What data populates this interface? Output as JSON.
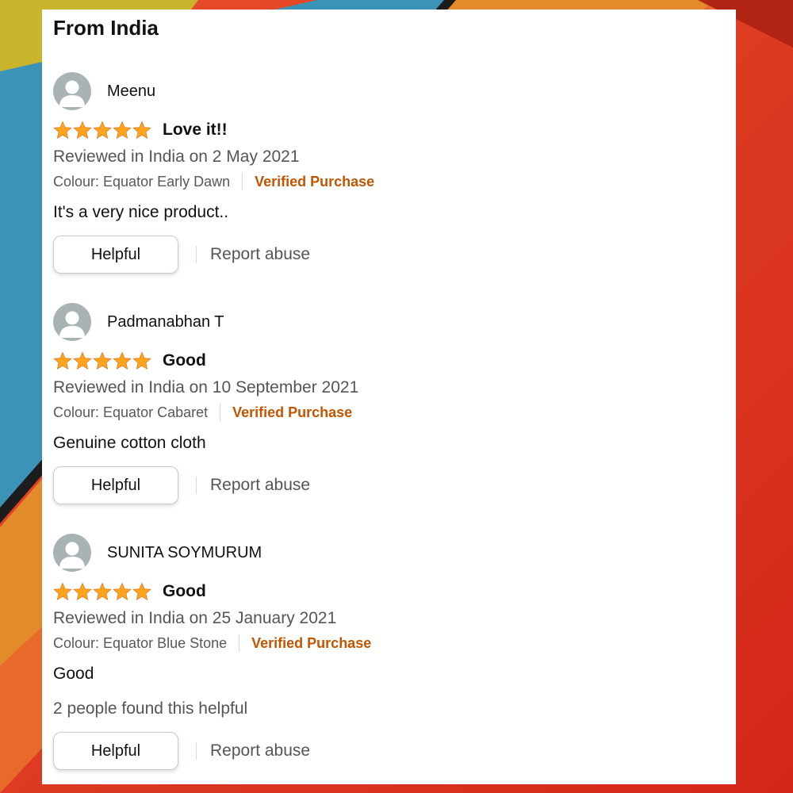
{
  "heading": "From India",
  "colors": {
    "star": "#ffa41c",
    "verified": "#c45500",
    "muted_text": "#555555",
    "button_border": "#c8cccc"
  },
  "icons": {
    "avatar": "user-silhouette-icon",
    "rating": "star-icon"
  },
  "reviews": [
    {
      "name": "Meenu",
      "stars": 5,
      "title": "Love it!!",
      "date": "Reviewed in India on 2 May 2021",
      "colour": "Colour: Equator Early Dawn",
      "verified": "Verified Purchase",
      "body": "It's a very nice product..",
      "helpful_label": "Helpful",
      "report_label": "Report abuse"
    },
    {
      "name": "Padmanabhan T",
      "stars": 5,
      "title": "Good",
      "date": "Reviewed in India on 10 September 2021",
      "colour": "Colour: Equator Cabaret",
      "verified": "Verified Purchase",
      "body": "Genuine cotton cloth",
      "helpful_label": "Helpful",
      "report_label": "Report abuse"
    },
    {
      "name": "SUNITA SOYMURUM",
      "stars": 5,
      "title": "Good",
      "date": "Reviewed in India on 25 January 2021",
      "colour": "Colour: Equator Blue Stone",
      "verified": "Verified Purchase",
      "body": "Good",
      "helpful_count": "2 people found this helpful",
      "helpful_label": "Helpful",
      "report_label": "Report abuse"
    }
  ]
}
